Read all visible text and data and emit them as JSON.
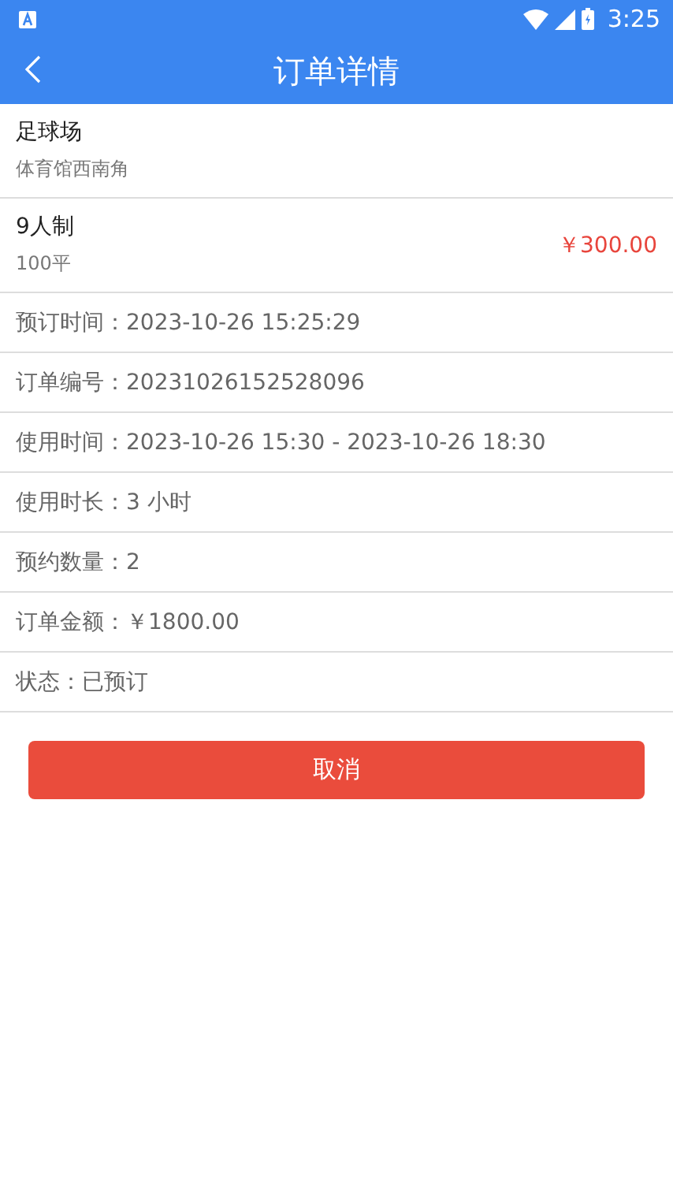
{
  "status_bar": {
    "time": "3:25"
  },
  "app_bar": {
    "title": "订单详情"
  },
  "venue": {
    "name": "足球场",
    "location": "体育馆西南角"
  },
  "plan": {
    "name": "9人制",
    "area": "100平",
    "price": "￥300.00"
  },
  "details": [
    {
      "text": "预订时间：2023-10-26 15:25:29"
    },
    {
      "text": "订单编号：20231026152528096"
    },
    {
      "text": "使用时间：2023-10-26 15:30 - 2023-10-26 18:30"
    },
    {
      "text": "使用时长：3 小时"
    },
    {
      "text": "预约数量：2"
    },
    {
      "text": "订单金额：￥1800.00"
    },
    {
      "text": "状态：已预订"
    }
  ],
  "cancel_button": {
    "label": "取消"
  }
}
